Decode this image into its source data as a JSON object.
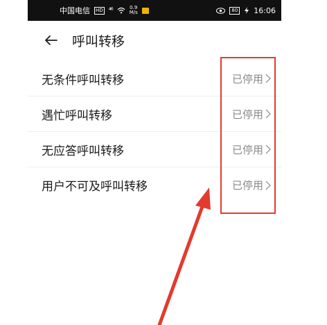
{
  "status_bar": {
    "carrier": "中国电信",
    "hd_badge": "HD",
    "signal": "⁴⁶",
    "speed_value": "0.9",
    "speed_unit": "M/s",
    "battery": "80",
    "time": "16:06"
  },
  "header": {
    "title": "呼叫转移",
    "back_icon": "back-arrow-icon"
  },
  "items": [
    {
      "label": "无条件呼叫转移",
      "value": "已停用"
    },
    {
      "label": "遇忙呼叫转移",
      "value": "已停用"
    },
    {
      "label": "无应答呼叫转移",
      "value": "已停用"
    },
    {
      "label": "用户不可及呼叫转移",
      "value": "已停用"
    }
  ],
  "colors": {
    "annotation": "#e23b2e",
    "status_bar": "#111111",
    "value_text": "#888888"
  }
}
